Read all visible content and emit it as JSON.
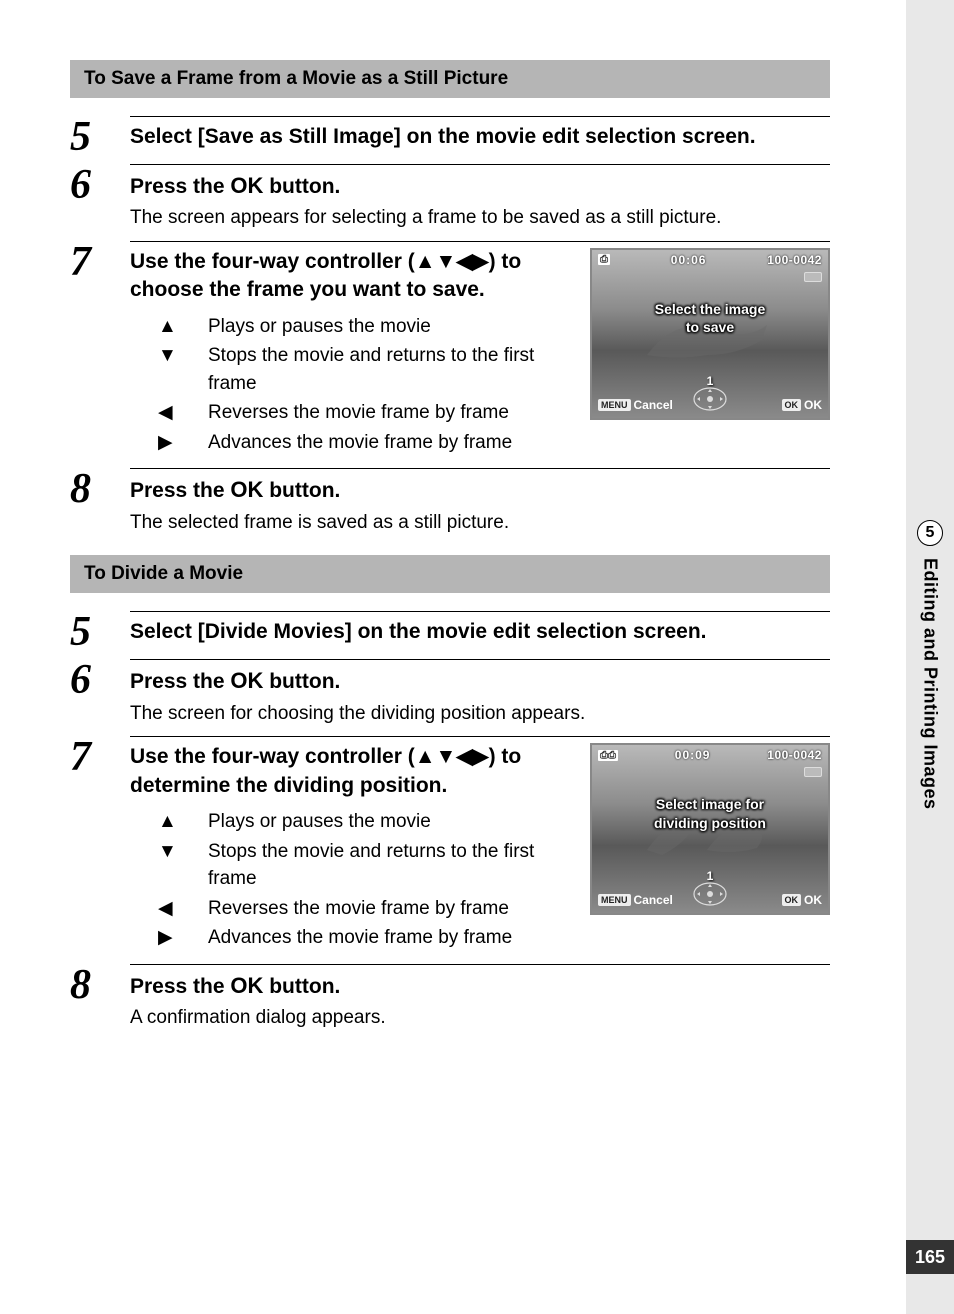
{
  "sidebar": {
    "chapter_num": "5",
    "chapter_title": "Editing and Printing Images",
    "page_num": "165"
  },
  "section1": {
    "header": "To Save a Frame from a Movie as a Still Picture",
    "steps": {
      "s5": {
        "num": "5",
        "title": "Select [Save as Still Image] on the movie edit selection screen."
      },
      "s6": {
        "num": "6",
        "title_pre": "Press the ",
        "ok": "OK",
        "title_post": " button.",
        "desc": "The screen appears for selecting a frame to be saved as a still picture."
      },
      "s7": {
        "num": "7",
        "title": "Use the four-way controller (▲▼◀▶) to choose the frame you want to save.",
        "controls": [
          {
            "sym": "▲",
            "txt": "Plays or pauses the movie"
          },
          {
            "sym": "▼",
            "txt": "Stops the movie and returns to the first frame"
          },
          {
            "sym": "◀",
            "txt": "Reverses the movie frame by frame"
          },
          {
            "sym": "▶",
            "txt": "Advances the movie frame by frame"
          }
        ],
        "lcd": {
          "timer": "00:06",
          "file": "100-0042",
          "msg1": "Select the image",
          "msg2": "to save",
          "one": "1",
          "menu": "MENU",
          "cancel": "Cancel",
          "ok_tag": "OK",
          "ok": "OK"
        }
      },
      "s8": {
        "num": "8",
        "title_pre": "Press the ",
        "ok": "OK",
        "title_post": " button.",
        "desc": "The selected frame is saved as a still picture."
      }
    }
  },
  "section2": {
    "header": "To Divide a Movie",
    "steps": {
      "s5": {
        "num": "5",
        "title": "Select [Divide Movies] on the movie edit selection screen."
      },
      "s6": {
        "num": "6",
        "title_pre": "Press the ",
        "ok": "OK",
        "title_post": " button.",
        "desc": "The screen for choosing the dividing position appears."
      },
      "s7": {
        "num": "7",
        "title": "Use the four-way controller (▲▼◀▶) to determine the dividing position.",
        "controls": [
          {
            "sym": "▲",
            "txt": "Plays or pauses the movie"
          },
          {
            "sym": "▼",
            "txt": "Stops the movie and returns to the first frame"
          },
          {
            "sym": "◀",
            "txt": "Reverses the movie frame by frame"
          },
          {
            "sym": "▶",
            "txt": "Advances the movie frame by frame"
          }
        ],
        "lcd": {
          "timer": "00:09",
          "file": "100-0042",
          "msg1": "Select image for",
          "msg2": "dividing position",
          "one": "1",
          "menu": "MENU",
          "cancel": "Cancel",
          "ok_tag": "OK",
          "ok": "OK"
        }
      },
      "s8": {
        "num": "8",
        "title_pre": "Press the ",
        "ok": "OK",
        "title_post": " button.",
        "desc": "A confirmation dialog appears."
      }
    }
  }
}
